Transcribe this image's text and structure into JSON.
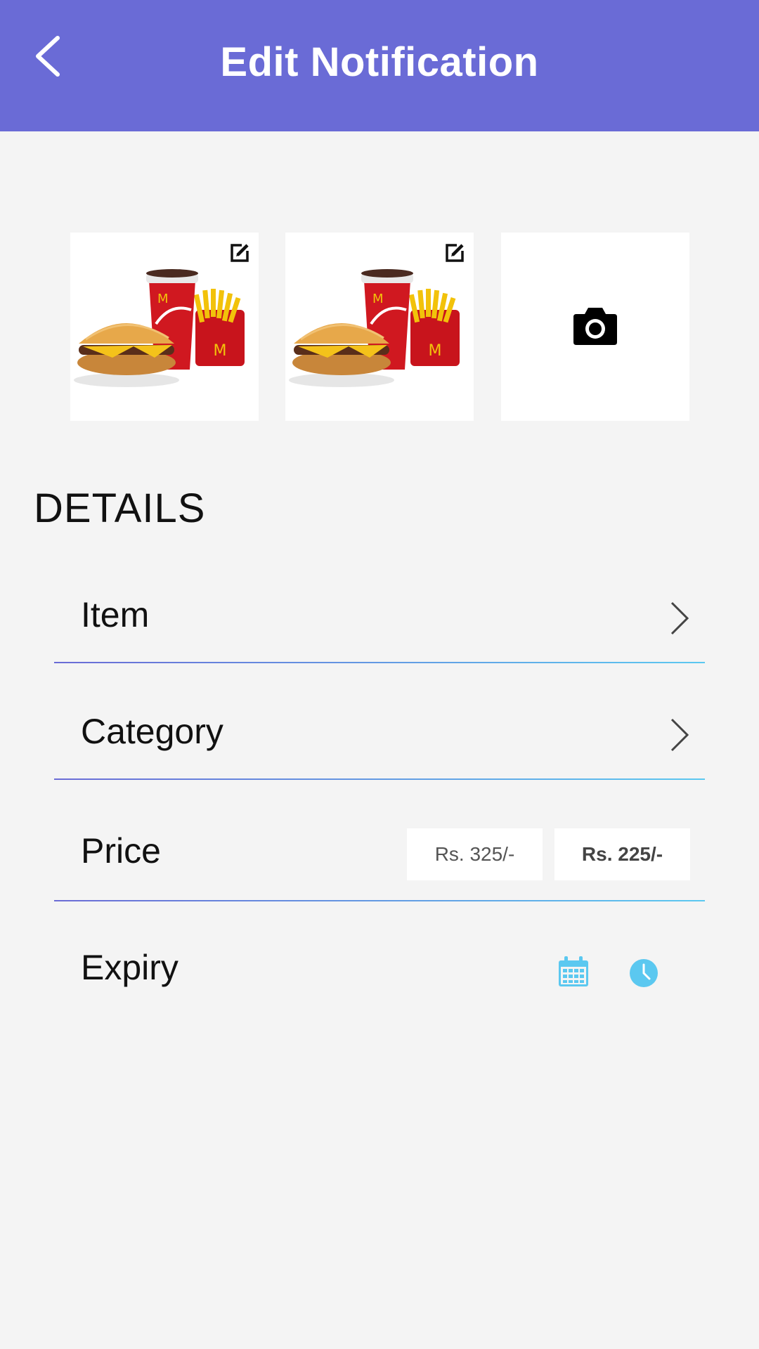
{
  "header": {
    "title": "Edit Notification",
    "back_icon": "chevron-left-icon",
    "background_color": "#6a6bd6"
  },
  "photos": [
    {
      "name": "burger-combo-photo-1",
      "edit_icon": "edit-icon"
    },
    {
      "name": "burger-combo-photo-2",
      "edit_icon": "edit-icon"
    },
    {
      "name": "add-photo-slot",
      "icon": "camera-icon"
    }
  ],
  "details": {
    "section_title": "DETAILS",
    "item": {
      "label": "Item",
      "icon": "chevron-right-icon"
    },
    "category": {
      "label": "Category",
      "icon": "chevron-right-icon"
    },
    "price": {
      "label": "Price",
      "original_price": "Rs. 325/-",
      "offer_price": "Rs. 225/-"
    },
    "expiry": {
      "label": "Expiry",
      "date_icon": "calendar-icon",
      "time_icon": "clock-icon",
      "icon_color": "#5bc8f0"
    }
  }
}
